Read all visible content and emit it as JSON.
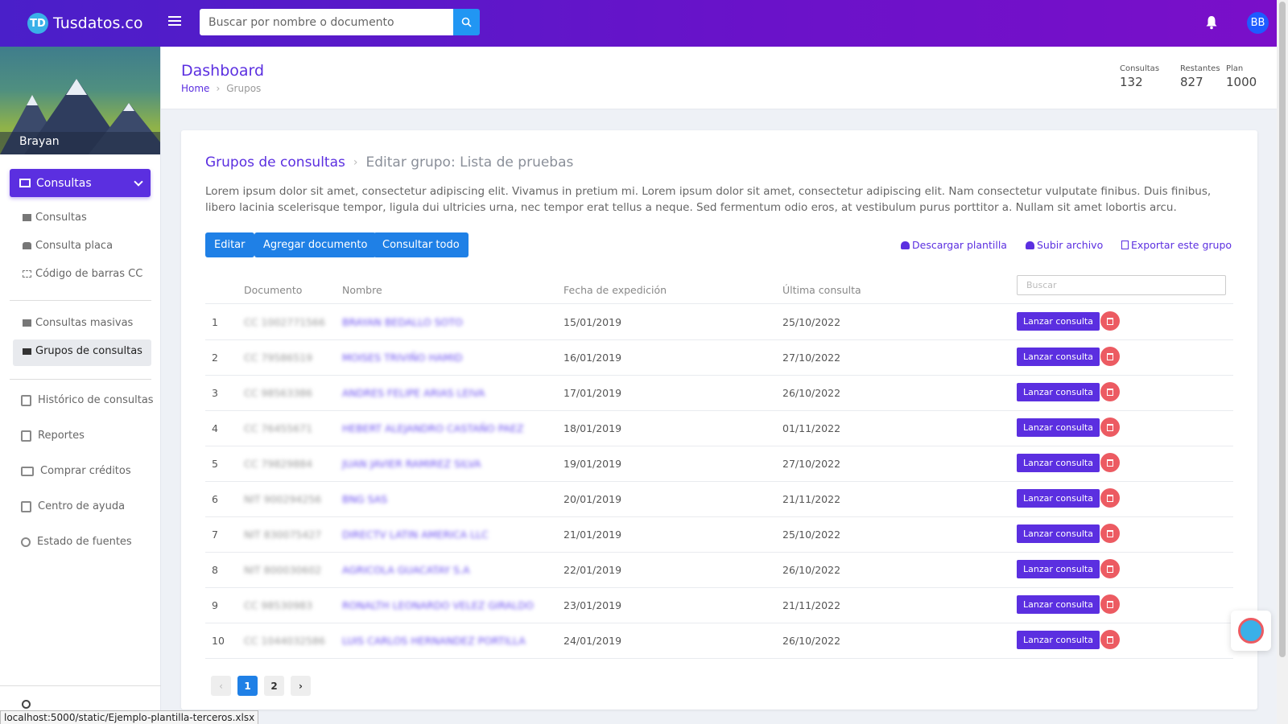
{
  "app": {
    "logo_text": "Tusdatos.co",
    "logo_mark": "TD",
    "search_placeholder": "Buscar por nombre o documento",
    "user_initials": "BB"
  },
  "sidebar": {
    "user_name": "Brayan",
    "main_item": "Consultas",
    "sub_items": [
      "Consultas",
      "Consulta placa",
      "Código de barras CC",
      "Consultas masivas",
      "Grupos de consultas"
    ],
    "nav_items": [
      "Histórico de consultas",
      "Reportes",
      "Comprar créditos",
      "Centro de ayuda",
      "Estado de fuentes"
    ]
  },
  "header": {
    "title": "Dashboard",
    "breadcrumb_home": "Home",
    "breadcrumb_current": "Grupos",
    "stats": [
      {
        "label": "Consultas",
        "value": "132"
      },
      {
        "label": "Restantes",
        "value": "827"
      },
      {
        "label": "Plan",
        "value": "1000"
      }
    ]
  },
  "card": {
    "crumb_link": "Grupos de consultas",
    "crumb_current": "Editar grupo: Lista de pruebas",
    "description": "Lorem ipsum dolor sit amet, consectetur adipiscing elit. Vivamus in pretium mi. Lorem ipsum dolor sit amet, consectetur adipiscing elit. Nam consectetur vulputate finibus. Duis finibus, libero lacinia scelerisque tempor, ligula dui ultricies urna, nec tempor erat tellus a neque. Sed fermentum odio eros, at vestibulum purus porttitor a. Nullam sit amet lobortis arcu.",
    "buttons": [
      "Editar",
      "Agregar documento",
      "Consultar todo"
    ],
    "links": [
      "Descargar plantilla",
      "Subir archivo",
      "Exportar este grupo"
    ]
  },
  "table": {
    "columns": [
      "Documento",
      "Nombre",
      "Fecha de expedición",
      "Última consulta"
    ],
    "search_placeholder": "Buscar",
    "launch_label": "Lanzar consulta",
    "rows": [
      {
        "n": "1",
        "doc": "CC 1002771566",
        "name": "BRAYAN BEDALLO SOTO",
        "issued": "15/01/2019",
        "last": "25/10/2022"
      },
      {
        "n": "2",
        "doc": "CC 79586519",
        "name": "MOISES TRIVIÑO HAMID",
        "issued": "16/01/2019",
        "last": "27/10/2022"
      },
      {
        "n": "3",
        "doc": "CC 98563386",
        "name": "ANDRES FELIPE ARIAS LEIVA",
        "issued": "17/01/2019",
        "last": "26/10/2022"
      },
      {
        "n": "4",
        "doc": "CC 76455671",
        "name": "HEBERT ALEJANDRO CASTAÑO PAEZ",
        "issued": "18/01/2019",
        "last": "01/11/2022"
      },
      {
        "n": "5",
        "doc": "CC 79829884",
        "name": "JUAN JAVIER RAMIREZ SILVA",
        "issued": "19/01/2019",
        "last": "27/10/2022"
      },
      {
        "n": "6",
        "doc": "NIT 900294256",
        "name": "BNG SAS",
        "issued": "20/01/2019",
        "last": "21/11/2022"
      },
      {
        "n": "7",
        "doc": "NIT 830075427",
        "name": "DIRECTV LATIN AMERICA LLC",
        "issued": "21/01/2019",
        "last": "25/10/2022"
      },
      {
        "n": "8",
        "doc": "NIT 800030602",
        "name": "AGRICOLA GUACATAY S.A",
        "issued": "22/01/2019",
        "last": "26/10/2022"
      },
      {
        "n": "9",
        "doc": "CC 98530983",
        "name": "RONALTH LEONARDO VELEZ GIRALDO",
        "issued": "23/01/2019",
        "last": "21/11/2022"
      },
      {
        "n": "10",
        "doc": "CC 1044032586",
        "name": "LUIS CARLOS HERNANDEZ PORTILLA",
        "issued": "24/01/2019",
        "last": "26/10/2022"
      }
    ],
    "pages": [
      "1",
      "2"
    ],
    "current_page": "1"
  },
  "status_url": "localhost:5000/static/Ejemplo-plantilla-terceros.xlsx"
}
